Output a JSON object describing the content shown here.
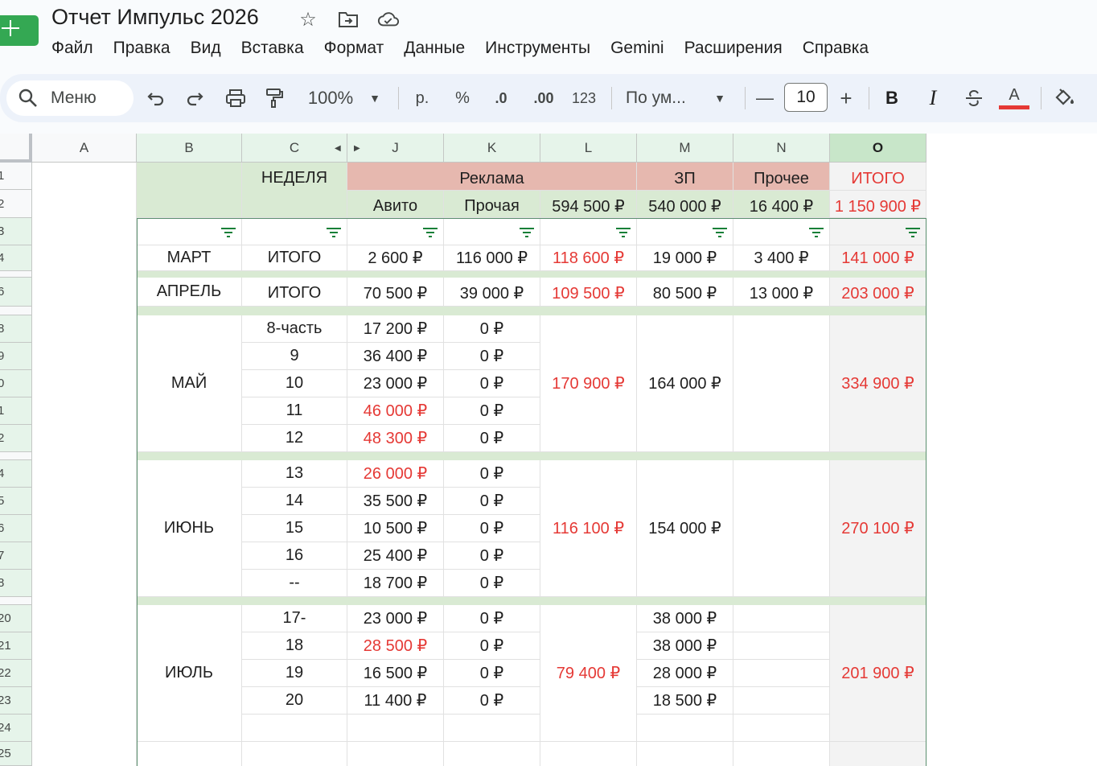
{
  "app": {
    "title": "Отчет Импульс 2026",
    "icons": [
      "star-icon",
      "move-to-folder-icon",
      "cloud-status-icon"
    ]
  },
  "menu": [
    "Файл",
    "Правка",
    "Вид",
    "Вставка",
    "Формат",
    "Данные",
    "Инструменты",
    "Gemini",
    "Расширения",
    "Справка"
  ],
  "toolbar": {
    "search_label": "Меню",
    "zoom": "100%",
    "currency": "р.",
    "percent": "%",
    "dec_decrease": ".0",
    "dec_increase": ".00",
    "format_123": "123",
    "font_name": "По ум...",
    "font_size": "10",
    "minus": "—",
    "plus": "+",
    "bold": "B",
    "italic": "I",
    "text_color_glyph": "A",
    "text_color": "#e53935"
  },
  "columns": [
    "A",
    "B",
    "C",
    "J",
    "K",
    "L",
    "M",
    "N",
    "O"
  ],
  "row_numbers": [
    "1",
    "2",
    "3",
    "4",
    "6",
    "8",
    "9",
    "0",
    "1",
    "2",
    "4",
    "5",
    "6",
    "7",
    "8",
    "20",
    "21",
    "22",
    "23",
    "24",
    "25"
  ],
  "header": {
    "week_label": "НЕДЕЛЯ",
    "ads_label": "Реклама",
    "salary_label": "ЗП",
    "other_label": "Прочее",
    "total_label": "ИТОГО",
    "avito_label": "Авито",
    "other_ads_label": "Прочая",
    "ads_sum": "594 500 ₽",
    "salary_sum": "540 000 ₽",
    "other_sum": "16 400 ₽",
    "grand_total": "1 150 900 ₽"
  },
  "march": {
    "month": "МАРТ",
    "week": "ИТОГО",
    "avito": "2 600 ₽",
    "other_ads": "116 000 ₽",
    "ads_total": "118 600 ₽",
    "salary": "19 000 ₽",
    "other": "3 400 ₽",
    "total": "141 000 ₽"
  },
  "april": {
    "month": "АПРЕЛЬ",
    "week": "ИТОГО",
    "avito": "70 500 ₽",
    "other_ads": "39 000 ₽",
    "ads_total": "109 500 ₽",
    "salary": "80 500 ₽",
    "other": "13 000 ₽",
    "total": "203 000 ₽"
  },
  "may": {
    "month": "МАЙ",
    "weeks": [
      {
        "week": "8-часть",
        "avito": "17 200 ₽",
        "other_ads": "0 ₽",
        "avito_red": false
      },
      {
        "week": "9",
        "avito": "36 400 ₽",
        "other_ads": "0 ₽",
        "avito_red": false
      },
      {
        "week": "10",
        "avito": "23 000 ₽",
        "other_ads": "0 ₽",
        "avito_red": false
      },
      {
        "week": "11",
        "avito": "46 000 ₽",
        "other_ads": "0 ₽",
        "avito_red": true
      },
      {
        "week": "12",
        "avito": "48 300 ₽",
        "other_ads": "0 ₽",
        "avito_red": true
      }
    ],
    "ads_total": "170 900 ₽",
    "salary": "164 000 ₽",
    "total": "334 900 ₽"
  },
  "june": {
    "month": "ИЮНЬ",
    "weeks": [
      {
        "week": "13",
        "avito": "26 000 ₽",
        "other_ads": "0 ₽",
        "avito_red": true
      },
      {
        "week": "14",
        "avito": "35 500 ₽",
        "other_ads": "0 ₽",
        "avito_red": false
      },
      {
        "week": "15",
        "avito": "10 500 ₽",
        "other_ads": "0 ₽",
        "avito_red": false
      },
      {
        "week": "16",
        "avito": "25 400 ₽",
        "other_ads": "0 ₽",
        "avito_red": false
      },
      {
        "week": "--",
        "avito": "18 700 ₽",
        "other_ads": "0 ₽",
        "avito_red": false
      }
    ],
    "ads_total": "116 100 ₽",
    "salary": "154 000 ₽",
    "total": "270 100 ₽"
  },
  "july": {
    "month": "ИЮЛЬ",
    "weeks": [
      {
        "week": "17-",
        "avito": "23 000 ₽",
        "other_ads": "0 ₽",
        "salary": "38 000 ₽",
        "avito_red": false
      },
      {
        "week": "18",
        "avito": "28 500 ₽",
        "other_ads": "0 ₽",
        "salary": "38 000 ₽",
        "avito_red": true
      },
      {
        "week": "19",
        "avito": "16 500 ₽",
        "other_ads": "0 ₽",
        "salary": "28 000 ₽",
        "avito_red": false
      },
      {
        "week": "20",
        "avito": "11 400 ₽",
        "other_ads": "0 ₽",
        "salary": "18 500 ₽",
        "avito_red": false
      }
    ],
    "ads_total": "79 400 ₽",
    "total": "201 900 ₽"
  },
  "colors": {
    "red_text": "#e53935",
    "header_green": "#d9ead3",
    "header_pink": "#e6b8af",
    "total_grey": "#f3f3f3",
    "logo_green": "#34a853"
  }
}
